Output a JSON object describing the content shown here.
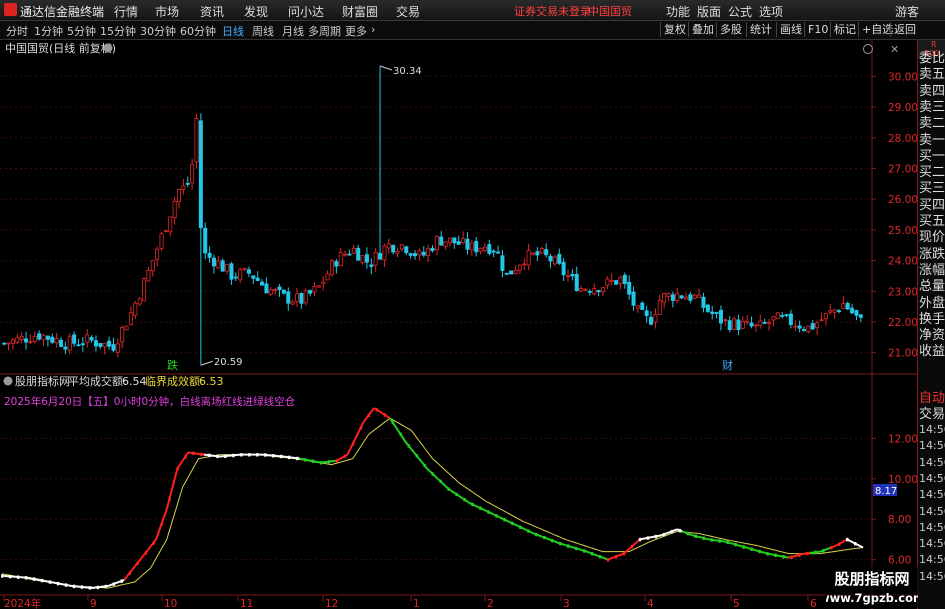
{
  "menubar": {
    "app_name": "通达信金融终端",
    "menus": [
      "行情",
      "市场",
      "资讯",
      "发现",
      "问小达",
      "财富圈",
      "交易"
    ],
    "warning": "证券交易未登录",
    "stock_name": "中国国贸",
    "right_menus": [
      "功能",
      "版面",
      "公式",
      "选项"
    ],
    "user": "游客"
  },
  "tabs": [
    "分时",
    "1分钟",
    "5分钟",
    "15分钟",
    "30分钟",
    "60分钟",
    "日线",
    "周线",
    "月线",
    "多周期",
    "更多"
  ],
  "active_tab": "日线",
  "toolbar_buttons": [
    "复权",
    "叠加",
    "多股",
    "统计",
    "画线",
    "F10",
    "标记",
    "+自选",
    "返回"
  ],
  "main_chart": {
    "title": "中国国贸(日线 前复权)",
    "price_axis": [
      "30.00",
      "29.00",
      "28.00",
      "27.00",
      "26.00",
      "25.00",
      "24.00",
      "23.00",
      "22.00",
      "21.00"
    ],
    "ylim": [
      20.5,
      30.6
    ],
    "high_label": "30.34",
    "low_label": "20.59",
    "event_labels": [
      "跌",
      "财"
    ]
  },
  "indicator": {
    "name": "股朋指标网",
    "avg_label": "平均成交额:",
    "avg_value": "6.54",
    "crit_label": "临界成效额:",
    "crit_value": "6.53",
    "signal_text": "2025年6月20日【五】0小时0分钟，白线离场红线进绿线空仓",
    "axis": [
      "12.00",
      "10.00",
      "8.00",
      "6.00"
    ],
    "ylim": [
      4.4,
      13.8
    ],
    "marker_value": "8.17"
  },
  "date_axis": [
    "2024年",
    "9",
    "10",
    "11",
    "12",
    "1",
    "2",
    "3",
    "4",
    "5",
    "6"
  ],
  "sidebar": {
    "badge_top": "R",
    "badge_bottom": "500",
    "items": [
      "委比",
      "卖五",
      "卖四",
      "卖三",
      "卖二",
      "卖一",
      "买一",
      "买二",
      "买三",
      "买四",
      "买五",
      "现价",
      "涨跌",
      "涨幅",
      "总量",
      "外盘",
      "换手",
      "净资",
      "收益"
    ],
    "auto_label": "自动",
    "trade_label": "交易",
    "times": [
      "14:56",
      "14:56",
      "14:56",
      "14:56",
      "14:56",
      "14:56",
      "14:56",
      "14:56",
      "14:56",
      "14:56"
    ]
  },
  "watermark": {
    "line1": "股朋指标网",
    "line2": "www.7gpzb.com"
  },
  "colors": {
    "up": "#e02828",
    "down": "#22c8e8",
    "grid_red": "#7a1a1a",
    "ind_red": "#ff2020",
    "ind_green": "#22d022",
    "ind_yellow": "#d8d04a",
    "ind_white": "#ffffff",
    "accent_blue": "#44aaff"
  },
  "chart_data": {
    "type": "candlestick",
    "count": 197,
    "anchors": [
      [
        0,
        21.3
      ],
      [
        12,
        21.6
      ],
      [
        22,
        21.3
      ],
      [
        30,
        21.4
      ],
      [
        38,
        21.2
      ],
      [
        44,
        22.2
      ],
      [
        50,
        23.5
      ],
      [
        56,
        25.0
      ],
      [
        61,
        26.3
      ],
      [
        64,
        26.4
      ],
      [
        66,
        27.2
      ],
      [
        67,
        30.1
      ],
      [
        68,
        25.8
      ],
      [
        70,
        24.2
      ],
      [
        74,
        24.0
      ],
      [
        80,
        23.5
      ],
      [
        86,
        23.6
      ],
      [
        92,
        23.1
      ],
      [
        98,
        22.8
      ],
      [
        104,
        22.7
      ],
      [
        110,
        23.1
      ],
      [
        116,
        24.0
      ],
      [
        122,
        24.4
      ],
      [
        128,
        23.9
      ],
      [
        134,
        24.5
      ],
      [
        140,
        24.5
      ],
      [
        146,
        24.1
      ],
      [
        152,
        24.7
      ],
      [
        158,
        24.6
      ],
      [
        164,
        24.4
      ],
      [
        168,
        24.5
      ],
      [
        172,
        24.4
      ],
      [
        176,
        23.5
      ],
      [
        182,
        24.1
      ],
      [
        188,
        24.2
      ],
      [
        192,
        24.0
      ],
      [
        196,
        23.6
      ],
      [
        202,
        23.1
      ],
      [
        210,
        23.2
      ],
      [
        216,
        23.4
      ],
      [
        222,
        22.3
      ],
      [
        226,
        22.0
      ],
      [
        230,
        22.8
      ],
      [
        236,
        22.9
      ],
      [
        242,
        22.8
      ],
      [
        246,
        22.4
      ],
      [
        252,
        22.0
      ],
      [
        258,
        21.9
      ],
      [
        264,
        21.8
      ],
      [
        270,
        22.1
      ],
      [
        276,
        22.0
      ],
      [
        282,
        21.8
      ],
      [
        288,
        22.2
      ],
      [
        294,
        22.6
      ],
      [
        300,
        22.0
      ]
    ],
    "indicator_series": {
      "price_line": [
        [
          0,
          5.2
        ],
        [
          10,
          5.1
        ],
        [
          18,
          4.9
        ],
        [
          26,
          4.7
        ],
        [
          34,
          4.6
        ],
        [
          40,
          4.7
        ],
        [
          46,
          5.0
        ],
        [
          52,
          6.0
        ],
        [
          58,
          7.0
        ],
        [
          62,
          8.5
        ],
        [
          66,
          10.5
        ],
        [
          70,
          11.3
        ],
        [
          76,
          11.2
        ],
        [
          82,
          11.1
        ],
        [
          90,
          11.2
        ],
        [
          98,
          11.2
        ],
        [
          106,
          11.1
        ],
        [
          112,
          11.0
        ],
        [
          120,
          10.8
        ],
        [
          126,
          10.9
        ],
        [
          130,
          11.2
        ],
        [
          136,
          12.8
        ],
        [
          140,
          13.5
        ],
        [
          146,
          13.0
        ],
        [
          152,
          11.8
        ],
        [
          160,
          10.5
        ],
        [
          168,
          9.5
        ],
        [
          176,
          8.8
        ],
        [
          184,
          8.3
        ],
        [
          192,
          7.8
        ],
        [
          200,
          7.3
        ],
        [
          210,
          6.8
        ],
        [
          220,
          6.4
        ],
        [
          228,
          6.0
        ],
        [
          234,
          6.3
        ],
        [
          240,
          7.0
        ],
        [
          248,
          7.2
        ],
        [
          254,
          7.5
        ],
        [
          260,
          7.2
        ],
        [
          266,
          7.0
        ],
        [
          272,
          6.9
        ],
        [
          280,
          6.6
        ],
        [
          288,
          6.3
        ],
        [
          296,
          6.1
        ],
        [
          302,
          6.3
        ],
        [
          308,
          6.4
        ],
        [
          314,
          6.7
        ],
        [
          318,
          7.0
        ],
        [
          324,
          6.6
        ]
      ],
      "smooth_line": [
        [
          0,
          5.3
        ],
        [
          12,
          5.0
        ],
        [
          26,
          4.7
        ],
        [
          40,
          4.6
        ],
        [
          50,
          4.9
        ],
        [
          56,
          5.6
        ],
        [
          62,
          7.0
        ],
        [
          68,
          9.6
        ],
        [
          74,
          11.0
        ],
        [
          82,
          11.2
        ],
        [
          96,
          11.2
        ],
        [
          110,
          11.0
        ],
        [
          124,
          10.7
        ],
        [
          132,
          11.0
        ],
        [
          138,
          12.2
        ],
        [
          146,
          13.0
        ],
        [
          154,
          12.4
        ],
        [
          162,
          11.0
        ],
        [
          172,
          9.8
        ],
        [
          182,
          8.9
        ],
        [
          196,
          7.9
        ],
        [
          212,
          7.0
        ],
        [
          226,
          6.4
        ],
        [
          236,
          6.4
        ],
        [
          244,
          6.9
        ],
        [
          254,
          7.4
        ],
        [
          262,
          7.3
        ],
        [
          272,
          7.0
        ],
        [
          284,
          6.7
        ],
        [
          296,
          6.3
        ],
        [
          308,
          6.3
        ],
        [
          318,
          6.5
        ],
        [
          324,
          6.6
        ]
      ]
    },
    "indicator_colors_by_index": [
      [
        0,
        "white"
      ],
      [
        46,
        "red"
      ],
      [
        76,
        "white"
      ],
      [
        112,
        "green"
      ],
      [
        126,
        "red"
      ],
      [
        146,
        "green"
      ],
      [
        228,
        "red"
      ],
      [
        240,
        "white"
      ],
      [
        256,
        "green"
      ],
      [
        296,
        "red"
      ],
      [
        304,
        "green"
      ],
      [
        312,
        "red"
      ],
      [
        318,
        "white"
      ]
    ]
  }
}
